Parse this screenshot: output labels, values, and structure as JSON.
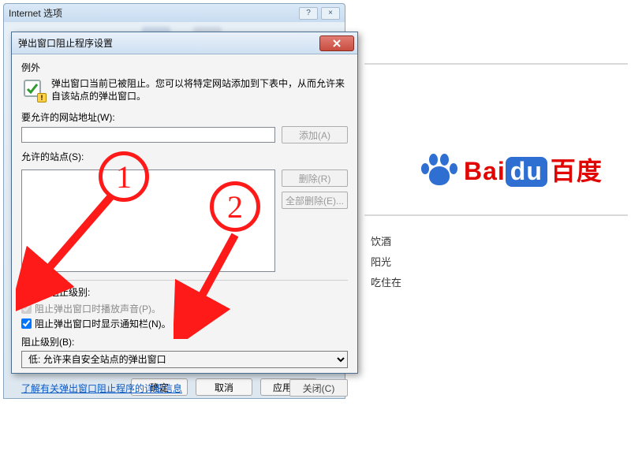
{
  "parent_dialog": {
    "title": "Internet 选项",
    "help_symbol": "?",
    "close_symbol": "×",
    "buttons": {
      "ok": "确定",
      "cancel": "取消",
      "apply": "应用(A)"
    }
  },
  "popup": {
    "title": "弹出窗口阻止程序设置",
    "exceptions_label": "例外",
    "info_text": "弹出窗口当前已被阻止。您可以将特定网站添加到下表中，从而允许来自该站点的弹出窗口。",
    "address_label": "要允许的网站地址(W):",
    "add_button": "添加(A)",
    "allowed_label": "允许的站点(S):",
    "remove_button": "删除(R)",
    "remove_all_button": "全部删除(E)...",
    "group_label": "通知和阻止级别:",
    "play_sound_label": "阻止弹出窗口时播放声音(P)。",
    "show_bar_label": "阻止弹出窗口时显示通知栏(N)。",
    "play_sound_checked": true,
    "show_bar_checked": true,
    "level_label": "阻止级别(B):",
    "level_value": "低: 允许来自安全站点的弹出窗口",
    "learn_more": "了解有关弹出窗口阻止程序的详细信息",
    "close_button": "关闭(C)"
  },
  "baidu": {
    "brand_bai": "Bai",
    "brand_du": "du",
    "brand_cn": "百度",
    "hint1": "饮酒",
    "hint2": "阳光",
    "hint3": "吃住在"
  },
  "annotations": {
    "one": "1",
    "two": "2"
  }
}
